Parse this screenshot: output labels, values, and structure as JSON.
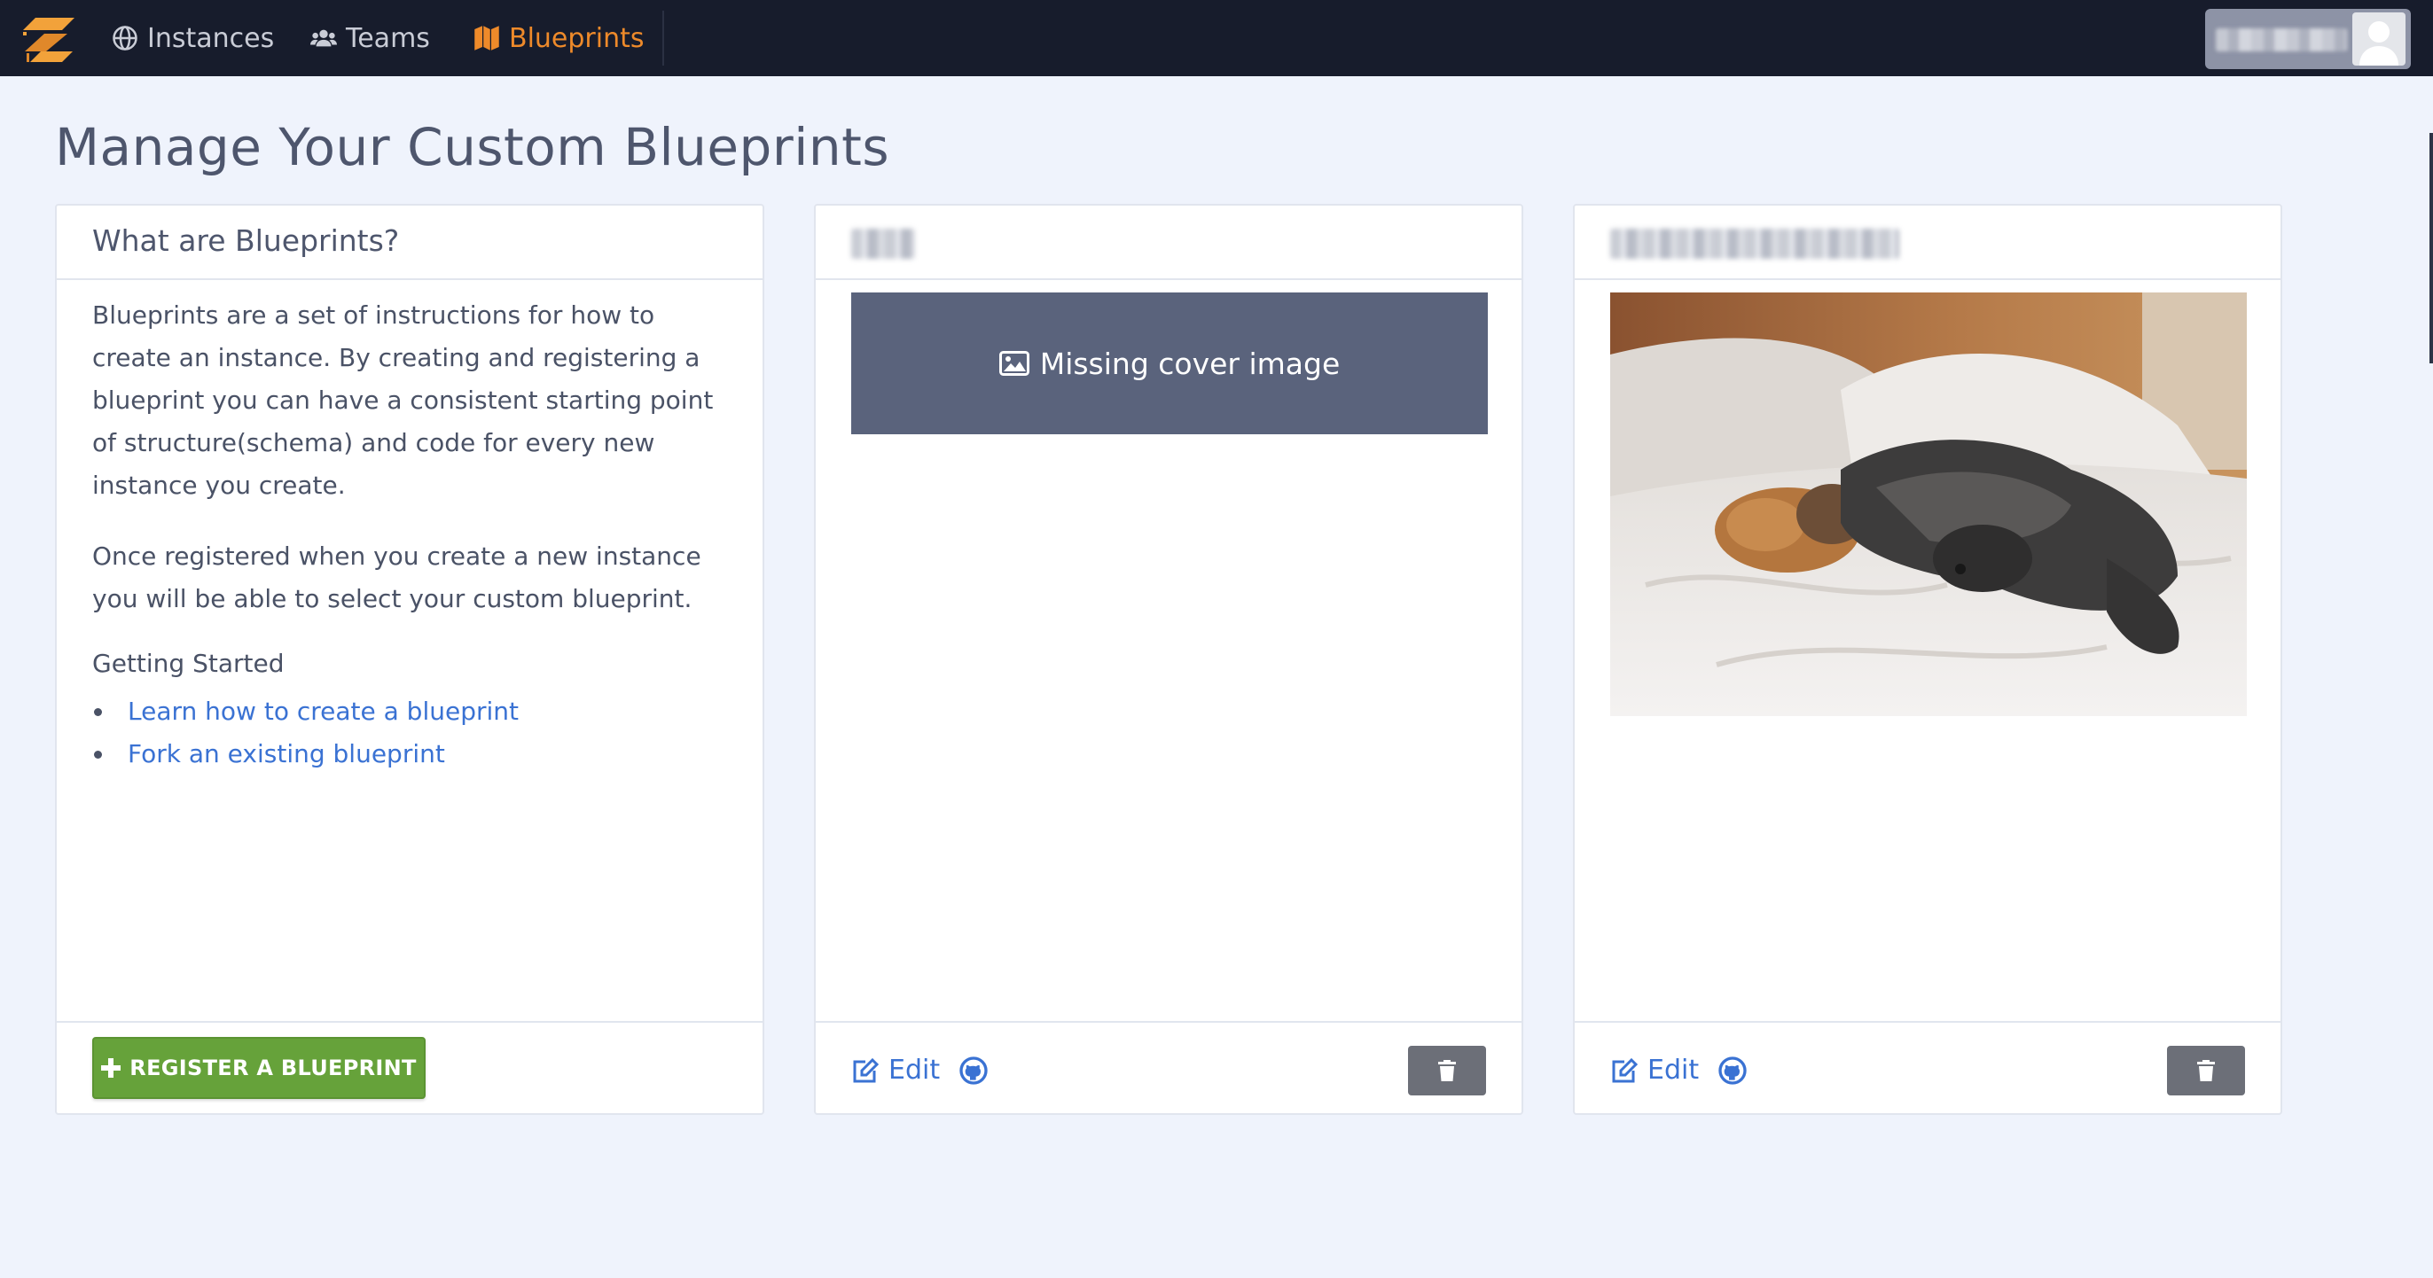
{
  "nav": {
    "items": [
      {
        "label": "Instances",
        "icon": "globe-icon"
      },
      {
        "label": "Teams",
        "icon": "users-icon"
      },
      {
        "label": "Blueprints",
        "icon": "map-icon",
        "active": true
      }
    ],
    "active_color": "#ee8a2a"
  },
  "page": {
    "title": "Manage Your Custom Blueprints"
  },
  "info_card": {
    "title": "What are Blueprints?",
    "paragraph_1": "Blueprints are a set of instructions for how to create an instance. By creating and registering a blueprint you can have a consistent starting point of structure(schema) and code for every new instance you create.",
    "paragraph_2": "Once registered when you create a new instance you will be able to select your custom blueprint.",
    "getting_started": "Getting Started",
    "links": [
      "Learn how to create a blueprint",
      "Fork an existing blueprint"
    ],
    "register_button": "REGISTER A BLUEPRINT"
  },
  "blueprints": [
    {
      "missing_cover_text": "Missing cover image",
      "edit_label": "Edit"
    },
    {
      "edit_label": "Edit"
    }
  ],
  "colors": {
    "navbar": "#171c2c",
    "background": "#eff3fc",
    "link": "#3a72d3",
    "register": "#66a23a",
    "missing_cover": "#5a637c",
    "delete": "#6c6f78"
  }
}
